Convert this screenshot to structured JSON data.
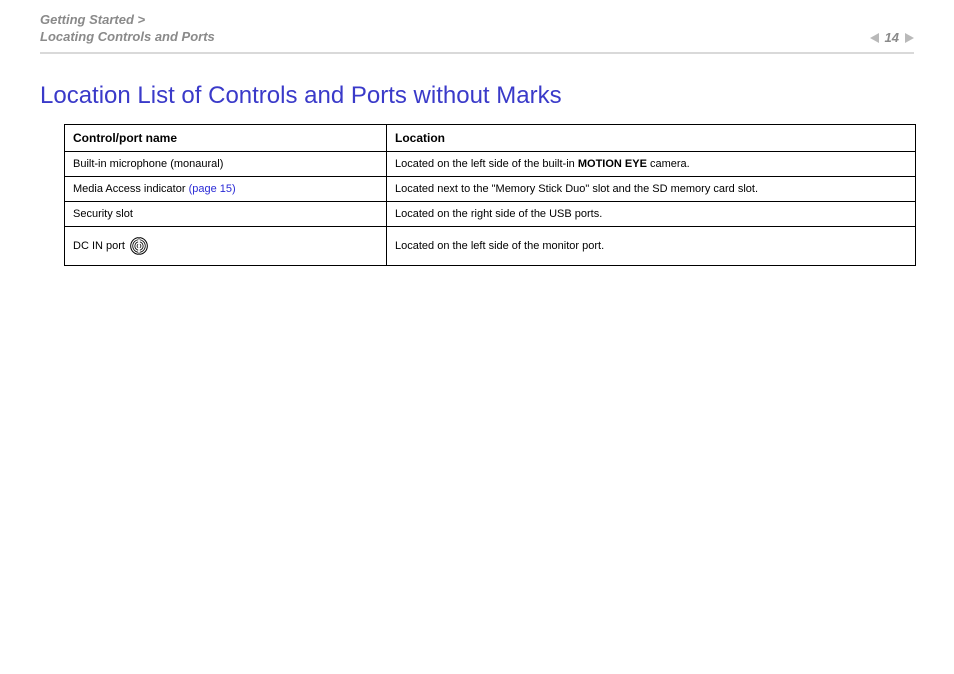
{
  "breadcrumb": {
    "line1": "Getting Started >",
    "line2": "Locating Controls and Ports"
  },
  "pager": {
    "page_number": "14"
  },
  "title": "Location List of Controls and Ports without Marks",
  "table": {
    "headers": {
      "col1": "Control/port name",
      "col2": "Location"
    },
    "rows": {
      "r0": {
        "name": "Built-in microphone (monaural)",
        "loc_pre": "Located on the left side of the built-in ",
        "loc_bold": "MOTION EYE",
        "loc_post": " camera."
      },
      "r1": {
        "name_pre": "Media Access indicator ",
        "name_link": "(page 15)",
        "loc": "Located next to the \"Memory Stick Duo\" slot and the SD memory card slot."
      },
      "r2": {
        "name": "Security slot",
        "loc": "Located on the right side of the USB ports."
      },
      "r3": {
        "name": "DC IN port",
        "loc": "Located on the left side of the monitor port."
      }
    }
  }
}
